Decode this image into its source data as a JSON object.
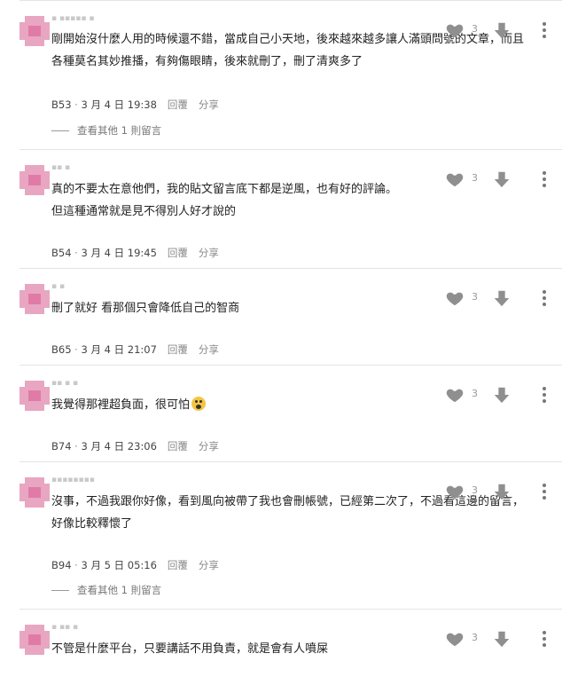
{
  "comments": [
    {
      "user_display": "▪ ▪▪▪▪▪ ▪",
      "text": "剛開始沒什麼人用的時候還不錯，當成自己小天地，後來越來越多讓人滿頭問號的文章，而且\n各種莫名其妙推播，有夠傷眼睛，後來就刪了，刪了清爽多了",
      "floor": "B53",
      "date": "3 月 4 日 19:38",
      "like_count": "3",
      "reply_label": "回覆",
      "share_label": "分享",
      "more_replies": "查看其他 1 則留言"
    },
    {
      "user_display": "▪▪ ▪",
      "text": "真的不要太在意他們，我的貼文留言底下都是逆風，也有好的評論。\n但這種通常就是見不得別人好才說的",
      "floor": "B54",
      "date": "3 月 4 日 19:45",
      "like_count": "3",
      "reply_label": "回覆",
      "share_label": "分享",
      "more_replies": ""
    },
    {
      "user_display": "▪ ▪",
      "text": "刪了就好 看那個只會降低自己的智商",
      "floor": "B65",
      "date": "3 月 4 日 21:07",
      "like_count": "3",
      "reply_label": "回覆",
      "share_label": "分享",
      "more_replies": ""
    },
    {
      "user_display": "▪▪ ▪ ▪",
      "text": "我覺得那裡超負面，很可怕",
      "floor": "B74",
      "date": "3 月 4 日 23:06",
      "like_count": "3",
      "reply_label": "回覆",
      "share_label": "分享",
      "more_replies": ""
    },
    {
      "user_display": "▪▪▪▪▪▪▪▪",
      "text": "沒事，不過我跟你好像，看到風向被帶了我也會刪帳號，已經第二次了，不過看這邊的留言，\n好像比較釋懷了",
      "floor": "B94",
      "date": "3 月 5 日 05:16",
      "like_count": "3",
      "reply_label": "回覆",
      "share_label": "分享",
      "more_replies": "查看其他 1 則留言"
    },
    {
      "user_display": "▪ ▪▪ ▪",
      "text": "不管是什麼平台，只要講話不用負責，就是會有人噴屎",
      "floor": "",
      "date": "",
      "like_count": "3",
      "reply_label": "",
      "share_label": "",
      "more_replies": ""
    }
  ],
  "icons": {
    "like": "heart-icon",
    "dislike": "thumb-down-arrow-icon",
    "menu": "more-vertical-icon",
    "emoji": "fearful-face-emoji"
  },
  "colors": {
    "avatar": "#e8a6c2",
    "icon": "#8f8f8f",
    "divider": "#e4e4e4"
  }
}
